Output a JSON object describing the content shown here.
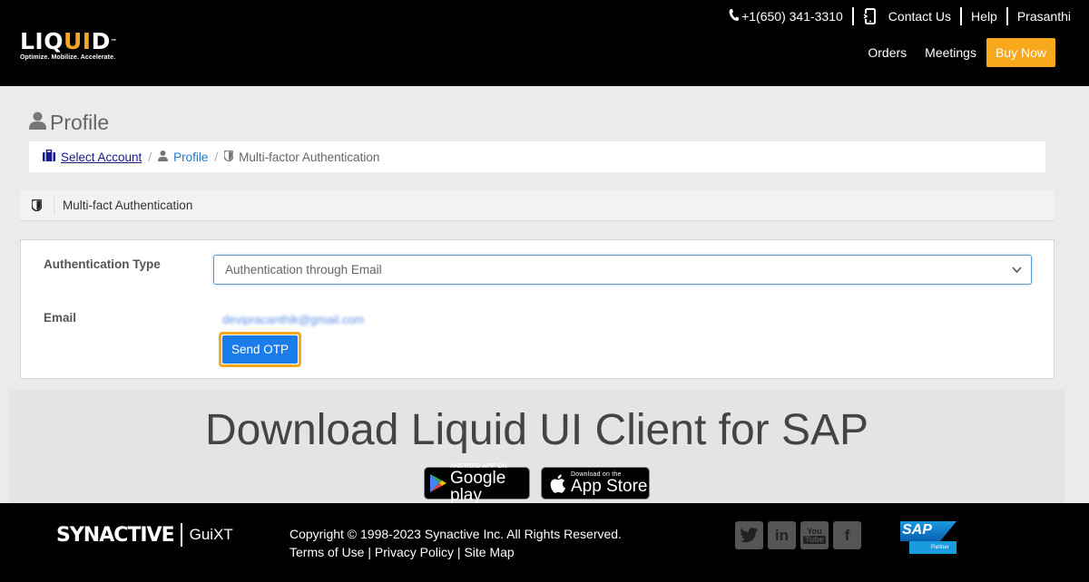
{
  "header": {
    "logo": {
      "text_main": "LIQ",
      "text_ui": "UI",
      "text_end": "D",
      "tagline": "Optimize. Mobilize. Accelerate."
    },
    "phone": "+1(650) 341-3310",
    "contact_label": "Contact Us",
    "help_label": "Help",
    "user_name": "Prasanthi",
    "nav": {
      "orders": "Orders",
      "meetings": "Meetings",
      "buy_now": "Buy Now"
    },
    "accent_color": "#f7a81b"
  },
  "page": {
    "title": "Profile",
    "breadcrumb": [
      {
        "label": "Select Account",
        "icon": "briefcase-icon"
      },
      {
        "label": "Profile",
        "icon": "user-icon"
      },
      {
        "label": "Multi-factor Authentication",
        "icon": "shield-icon"
      }
    ]
  },
  "panel": {
    "title": "Multi-fact Authentication",
    "auth_type_label": "Authentication Type",
    "auth_type_value": "Authentication through Email",
    "email_label": "Email",
    "email_value": "devipracanthik@gmail.com",
    "send_otp_label": "Send OTP"
  },
  "download": {
    "title": "Download Liquid UI Client for SAP",
    "google": {
      "small": "ANDROID APP ON",
      "big": "Google play"
    },
    "apple": {
      "small": "Download on the",
      "big": "App Store"
    }
  },
  "footer": {
    "brand": "SYNACTIVE",
    "product": "GuiXT",
    "copyright": "Copyright © 1998-2023 Synactive Inc. All Rights Reserved.",
    "links": {
      "terms": "Terms of Use",
      "privacy": "Privacy Policy",
      "sitemap": "Site Map"
    },
    "social": [
      "twitter-icon",
      "linkedin-icon",
      "youtube-icon",
      "facebook-icon"
    ],
    "partner": {
      "brand": "SAP",
      "label": "Partner"
    }
  }
}
